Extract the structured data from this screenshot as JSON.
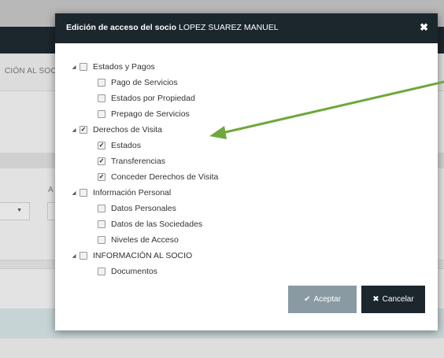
{
  "background": {
    "menu_text": "CIÓN AL SOCIO",
    "field_label": "A"
  },
  "modal": {
    "title_prefix": "Edición de acceso del socio",
    "title_name": "LOPEZ SUAREZ MANUEL",
    "close_icon": "times-icon",
    "tree": [
      {
        "label": "Estados y Pagos",
        "checked": false,
        "level": 0,
        "expanded": true,
        "children": [
          {
            "label": "Pago de Servicios",
            "checked": false
          },
          {
            "label": "Estados por Propiedad",
            "checked": false
          },
          {
            "label": "Prepago de Servicios",
            "checked": false
          }
        ]
      },
      {
        "label": "Derechos de Visita",
        "checked": true,
        "level": 0,
        "expanded": true,
        "children": [
          {
            "label": "Estados",
            "checked": true
          },
          {
            "label": "Transferencias",
            "checked": true
          },
          {
            "label": "Conceder Derechos de Visita",
            "checked": true
          }
        ]
      },
      {
        "label": "Información Personal",
        "checked": false,
        "level": 0,
        "expanded": true,
        "children": [
          {
            "label": "Datos Personales",
            "checked": false
          },
          {
            "label": "Datos de las Sociedades",
            "checked": false
          },
          {
            "label": "Niveles de Acceso",
            "checked": false
          }
        ]
      },
      {
        "label": "INFORMACIÓN AL SOCIO",
        "checked": false,
        "level": 0,
        "expanded": true,
        "children": [
          {
            "label": "Documentos",
            "checked": false
          }
        ]
      }
    ],
    "accept_label": "Aceptar",
    "cancel_label": "Cancelar"
  },
  "colors": {
    "header": "#1c262d",
    "accept_button": "#8a9aa3",
    "cancel_button": "#1c262d",
    "annotation_arrow": "#6fa83a"
  }
}
